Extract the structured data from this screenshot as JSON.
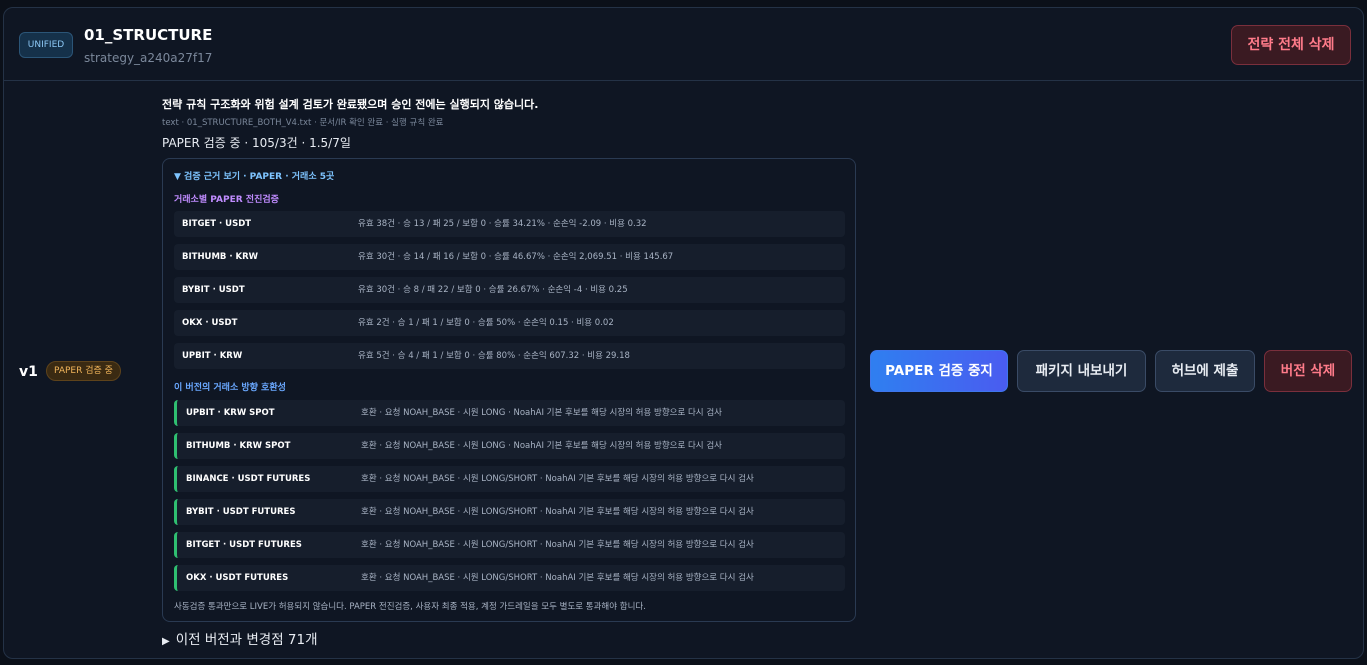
{
  "header": {
    "badge": "UNIFIED",
    "title": "01_STRUCTURE",
    "strategy_id": "strategy_a240a27f17",
    "delete_all_label": "전략 전체 삭제"
  },
  "version": {
    "label": "v1",
    "status_badge": "PAPER 검증 중"
  },
  "summary": {
    "message": "전략 규칙 구조화와 위험 설계 검토가 완료됐으며 승인 전에는 실행되지 않습니다.",
    "meta": "text · 01_STRUCTURE_BOTH_V4.txt · 문서/IR 확인 완료 · 실행 규칙 완료",
    "paper_status": "PAPER 검증 중 · 105/3건 · 1.5/7일"
  },
  "evidence": {
    "toggle": "▼ 검증 근거 보기 · PAPER · 거래소 5곳",
    "exchange_section_title": "거래소별 PAPER 전진검증",
    "exchange_rows": [
      {
        "name": "BITGET · USDT",
        "detail": "유효 38건 · 승 13 / 패 25 / 보합 0 · 승률 34.21% · 순손익 -2.09 · 비용 0.32"
      },
      {
        "name": "BITHUMB · KRW",
        "detail": "유효 30건 · 승 14 / 패 16 / 보합 0 · 승률 46.67% · 순손익 2,069.51 · 비용 145.67"
      },
      {
        "name": "BYBIT · USDT",
        "detail": "유효 30건 · 승 8 / 패 22 / 보합 0 · 승률 26.67% · 순손익 -4 · 비용 0.25"
      },
      {
        "name": "OKX · USDT",
        "detail": "유효 2건 · 승 1 / 패 1 / 보합 0 · 승률 50% · 순손익 0.15 · 비용 0.02"
      },
      {
        "name": "UPBIT · KRW",
        "detail": "유효 5건 · 승 4 / 패 1 / 보합 0 · 승률 80% · 순손익 607.32 · 비용 29.18"
      }
    ],
    "compat_section_title": "이 버전의 거래소 방향 호환성",
    "compat_rows": [
      {
        "name": "UPBIT · KRW SPOT",
        "detail": "호환 · 요청 NOAH_BASE · 시원 LONG · NoahAI 기본 후보를 해당 시장의 허용 방향으로 다시 검사"
      },
      {
        "name": "BITHUMB · KRW SPOT",
        "detail": "호환 · 요청 NOAH_BASE · 시원 LONG · NoahAI 기본 후보를 해당 시장의 허용 방향으로 다시 검사"
      },
      {
        "name": "BINANCE · USDT FUTURES",
        "detail": "호환 · 요청 NOAH_BASE · 시원 LONG/SHORT · NoahAI 기본 후보를 해당 시장의 허용 방향으로 다시 검사"
      },
      {
        "name": "BYBIT · USDT FUTURES",
        "detail": "호환 · 요청 NOAH_BASE · 시원 LONG/SHORT · NoahAI 기본 후보를 해당 시장의 허용 방향으로 다시 검사"
      },
      {
        "name": "BITGET · USDT FUTURES",
        "detail": "호환 · 요청 NOAH_BASE · 시원 LONG/SHORT · NoahAI 기본 후보를 해당 시장의 허용 방향으로 다시 검사"
      },
      {
        "name": "OKX · USDT FUTURES",
        "detail": "호환 · 요청 NOAH_BASE · 시원 LONG/SHORT · NoahAI 기본 후보를 해당 시장의 허용 방향으로 다시 검사"
      }
    ],
    "footnote": "사동검증 통과만으로 LIVE가 허용되지 않습니다. PAPER 전진검증, 사용자 최종 적용, 계정 가드레일을 모두 별도로 통과해야 합니다."
  },
  "changes": {
    "toggle_icon": "▶",
    "label": "이전 버전과 변경점 71개"
  },
  "actions": {
    "stop_paper": "PAPER 검증 중지",
    "export_package": "패키지 내보내기",
    "submit_hub": "허브에 제출",
    "delete_version": "버전 삭제"
  }
}
